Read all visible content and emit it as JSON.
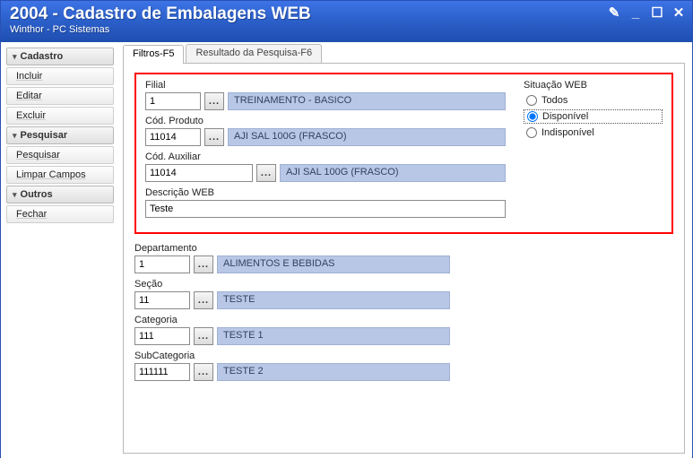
{
  "window": {
    "title": "2004 - Cadastro de Embalagens WEB",
    "subtitle": "Winthor - PC Sistemas"
  },
  "sidebar": {
    "groups": [
      {
        "label": "Cadastro",
        "items": [
          "Incluir",
          "Editar",
          "Excluir"
        ]
      },
      {
        "label": "Pesquisar",
        "items": [
          "Pesquisar",
          "Limpar Campos"
        ]
      },
      {
        "label": "Outros",
        "items": [
          "Fechar"
        ]
      }
    ]
  },
  "tabs": {
    "items": [
      "Filtros-F5",
      "Resultado da Pesquisa-F6"
    ],
    "active": 0
  },
  "filters": {
    "filial": {
      "label": "Filial",
      "value": "1",
      "desc": "TREINAMENTO - BASICO"
    },
    "codProduto": {
      "label": "Cód. Produto",
      "value": "11014",
      "desc": "AJI SAL 100G (FRASCO)"
    },
    "codAuxiliar": {
      "label": "Cód. Auxiliar",
      "value": "11014",
      "desc": "AJI SAL 100G (FRASCO)"
    },
    "descricaoWeb": {
      "label": "Descrição WEB",
      "value": "Teste"
    },
    "situacao": {
      "label": "Situação WEB",
      "options": [
        "Todos",
        "Disponível",
        "Indisponível"
      ],
      "selected": 1
    },
    "departamento": {
      "label": "Departamento",
      "value": "1",
      "desc": "ALIMENTOS E BEBIDAS"
    },
    "secao": {
      "label": "Seção",
      "value": "11",
      "desc": "TESTE"
    },
    "categoria": {
      "label": "Categoria",
      "value": "111",
      "desc": "TESTE 1"
    },
    "subcategoria": {
      "label": "SubCategoria",
      "value": "111111",
      "desc": "TESTE 2"
    }
  },
  "misc": {
    "ellipsis": "..."
  }
}
